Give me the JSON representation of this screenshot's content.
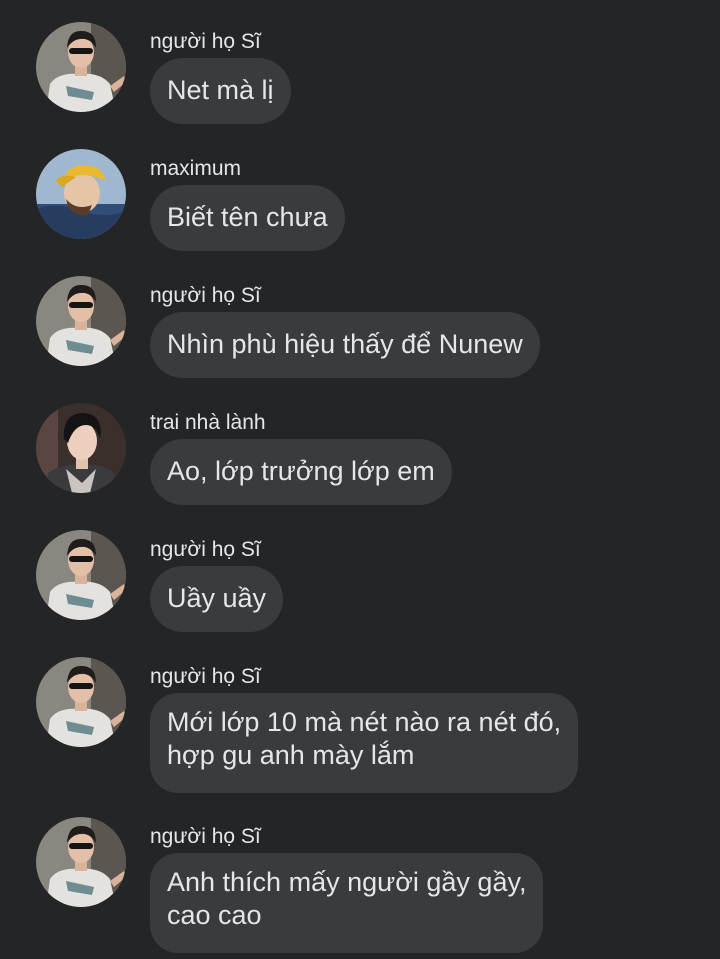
{
  "messages": [
    {
      "sender": "người họ Sĩ",
      "lines": [
        "Net mà lị"
      ],
      "avatar": "avatar-boy-sunglasses-icon"
    },
    {
      "sender": "maximum",
      "lines": [
        "Biết tên chưa"
      ],
      "avatar": "avatar-boy-yellow-cap-icon"
    },
    {
      "sender": "người họ Sĩ",
      "lines": [
        "Nhìn phù hiệu thấy để Nunew"
      ],
      "avatar": "avatar-boy-sunglasses-icon"
    },
    {
      "sender": "trai nhà lành",
      "lines": [
        "Ao, lớp trưởng lớp em"
      ],
      "avatar": "avatar-boy-dark-hair-icon"
    },
    {
      "sender": "người họ Sĩ",
      "lines": [
        "Uầy uầy"
      ],
      "avatar": "avatar-boy-sunglasses-icon"
    },
    {
      "sender": "người họ Sĩ",
      "lines": [
        "Mới lớp 10 mà nét nào ra nét đó,",
        "hợp gu anh mày lắm"
      ],
      "avatar": "avatar-boy-sunglasses-icon"
    },
    {
      "sender": "người họ Sĩ",
      "lines": [
        "Anh thích mấy người gầy gầy,",
        "cao cao"
      ],
      "avatar": "avatar-boy-sunglasses-icon"
    }
  ],
  "colors": {
    "background": "#242526",
    "bubble": "#3a3b3c",
    "text": "#e4e6eb"
  }
}
